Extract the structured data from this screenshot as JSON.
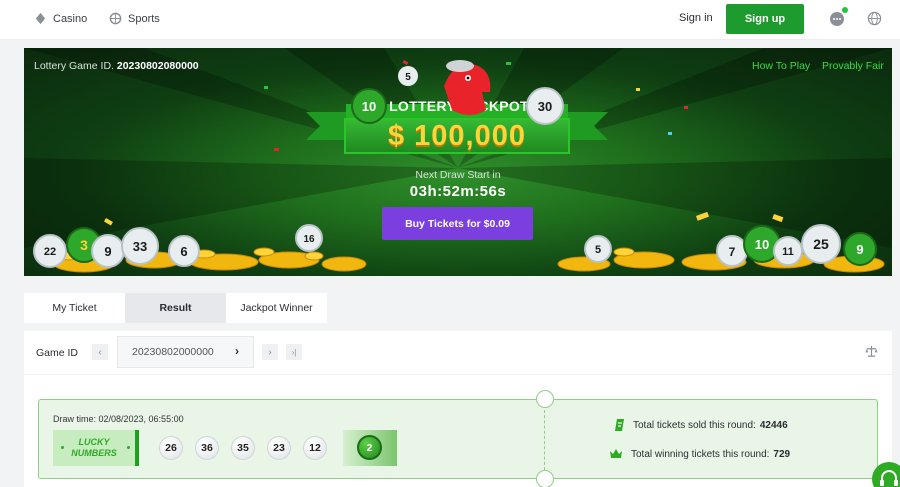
{
  "nav": {
    "casino": "Casino",
    "sports": "Sports",
    "signin": "Sign in",
    "signup": "Sign up"
  },
  "banner": {
    "game_id_label": "Lottery Game ID.",
    "game_id_value": "20230802080000",
    "how_to_play": "How To Play",
    "provably_fair": "Provably Fair",
    "title": "LOTTERY JACKPOT",
    "amount": "$ 100,000",
    "next_draw_label": "Next Draw Start in",
    "countdown": "03h:52m:56s",
    "buy_button": "Buy Tickets for $0.09",
    "deco_balls": [
      "10",
      "30",
      "5",
      "22",
      "3",
      "9",
      "33",
      "6",
      "16",
      "5",
      "7",
      "10",
      "11",
      "25",
      "9"
    ]
  },
  "tabs": [
    "My Ticket",
    "Result",
    "Jackpot Winner"
  ],
  "result": {
    "game_id_label": "Game ID",
    "game_id_value": "20230802000000",
    "draw_time": "Draw time: 02/08/2023, 06:55:00",
    "lucky_line1": "LUCKY",
    "lucky_line2": "NUMBERS",
    "numbers": [
      "26",
      "36",
      "35",
      "23",
      "12"
    ],
    "bonus": "2",
    "sold_label": "Total tickets sold this round:",
    "sold_value": "42446",
    "winning_label": "Total winning tickets this round:",
    "winning_value": "729"
  },
  "colors": {
    "brand_green": "#1e9b2e",
    "buy_purple": "#7b3fe0",
    "gold": "#ffd43a",
    "link_green": "#3fd84c"
  }
}
